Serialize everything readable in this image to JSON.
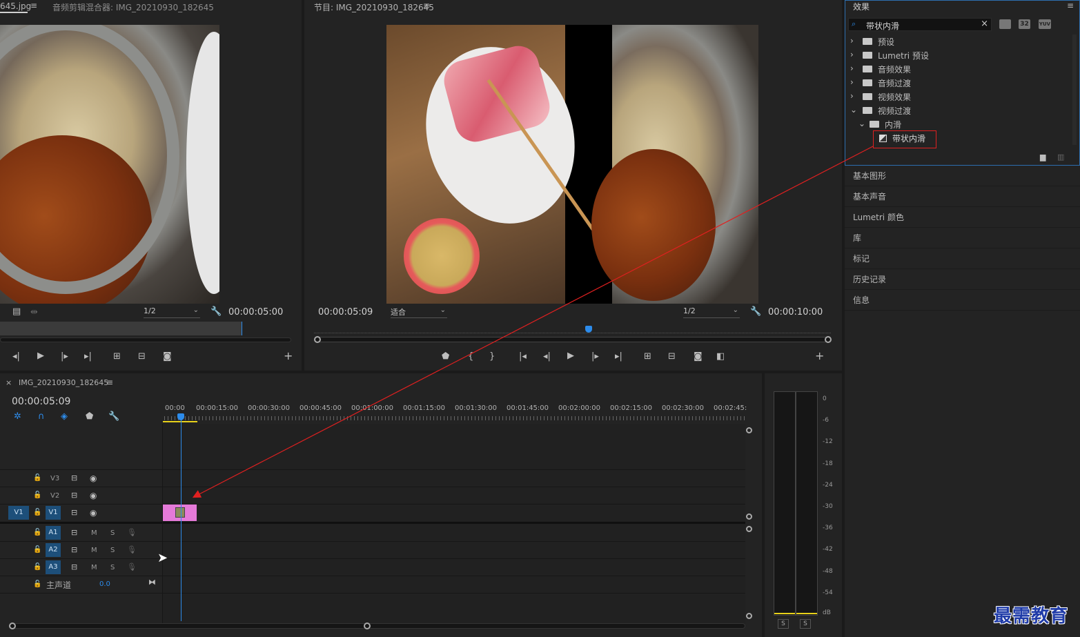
{
  "source_monitor": {
    "tab1": "645.jpg",
    "tab2": "音频剪辑混合器: IMG_20210930_182645",
    "zoom": "1/2",
    "timecode": "00:00:05:00"
  },
  "program_monitor": {
    "title": "节目: IMG_20210930_182645",
    "current_time": "00:00:05:09",
    "fit": "适合",
    "zoom": "1/2",
    "duration": "00:00:10:00"
  },
  "effects": {
    "title": "效果",
    "search_value": "带状内滑",
    "filter_32": "32",
    "filter_yuv": "YUV",
    "tree": [
      {
        "label": "预设",
        "arrow": "›"
      },
      {
        "label": "Lumetri 预设",
        "arrow": "›"
      },
      {
        "label": "音频效果",
        "arrow": "›"
      },
      {
        "label": "音频过渡",
        "arrow": "›"
      },
      {
        "label": "视频效果",
        "arrow": "›"
      },
      {
        "label": "视频过渡",
        "arrow": "⌄"
      },
      {
        "label": "内滑",
        "arrow": "⌄"
      },
      {
        "label": "带状内滑",
        "arrow": ""
      }
    ]
  },
  "side_panels": [
    "基本图形",
    "基本声音",
    "Lumetri 颜色",
    "库",
    "标记",
    "历史记录",
    "信息"
  ],
  "timeline": {
    "sequence_name": "IMG_20210930_182645",
    "timecode": "00:00:05:09",
    "ruler": [
      "00:00",
      "00:00:15:00",
      "00:00:30:00",
      "00:00:45:00",
      "00:01:00:00",
      "00:01:15:00",
      "00:01:30:00",
      "00:01:45:00",
      "00:02:00:00",
      "00:02:15:00",
      "00:02:30:00",
      "00:02:45:"
    ],
    "tracks": {
      "v3": "V3",
      "v2": "V2",
      "v1": "V1",
      "v1_src": "V1",
      "a1": "A1",
      "a2": "A2",
      "a3": "A3",
      "mute": "M",
      "solo": "S",
      "master": "主声道",
      "master_value": "0.0"
    }
  },
  "audio_meter": {
    "scale": [
      "0",
      "-6",
      "-12",
      "-18",
      "-24",
      "-30",
      "-36",
      "-42",
      "-48",
      "-54",
      "dB"
    ],
    "solo_left": "S",
    "solo_right": "S"
  },
  "watermark": "最需教育",
  "colors": {
    "accent_blue": "#2d8ceb",
    "clip_pink": "#e57ad8",
    "highlight_red": "#e02020",
    "panel_bg": "#232323"
  }
}
